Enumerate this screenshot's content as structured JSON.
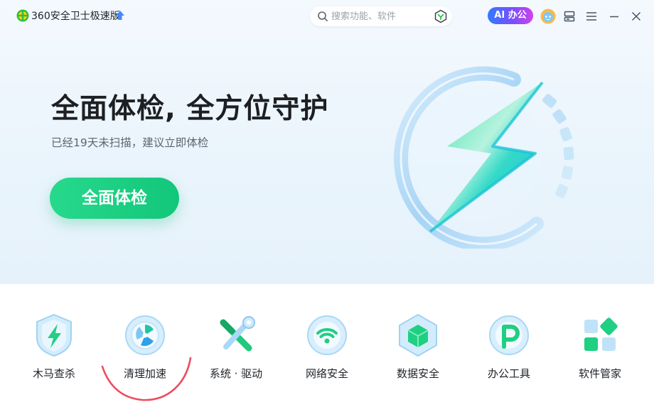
{
  "titlebar": {
    "app_name": "360安全卫士极速版",
    "logo_icon": "360-logo-icon",
    "upgrade_icon": "upgrade-arrow-icon",
    "search": {
      "placeholder": "搜索功能、软件",
      "value": "",
      "badge_icon": "shield-badge-icon"
    },
    "ai_button_label": "AI 办公",
    "avatar_icon": "avatar-icon",
    "controls": [
      "skin-icon",
      "menu-icon",
      "minimize-icon",
      "close-icon"
    ]
  },
  "hero": {
    "title": "全面体检, 全方位守护",
    "subtitle": "已经19天未扫描，建议立即体检",
    "scan_button": "全面体检",
    "emblem_icon": "lightning-ring-icon"
  },
  "tools": [
    {
      "label": "木马查杀",
      "icon": "trojan-scan-icon"
    },
    {
      "label": "清理加速",
      "icon": "cleanup-speedup-icon"
    },
    {
      "label": "系统 · 驱动",
      "icon": "system-driver-icon"
    },
    {
      "label": "网络安全",
      "icon": "network-security-icon"
    },
    {
      "label": "数据安全",
      "icon": "data-security-icon"
    },
    {
      "label": "办公工具",
      "icon": "office-tools-icon"
    },
    {
      "label": "软件管家",
      "icon": "software-manager-icon"
    }
  ],
  "colors": {
    "accent_green": "#1fcf82",
    "ai_gradient_start": "#2f7bff",
    "ai_gradient_end": "#d043e8",
    "annotation_red": "#ee4b5f"
  }
}
